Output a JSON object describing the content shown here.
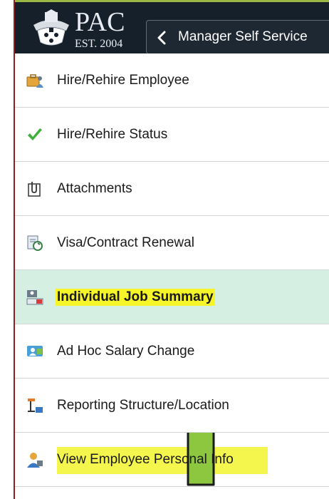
{
  "header": {
    "logo_text": "PAC",
    "logo_est": "EST. 2004",
    "back_label": "Manager Self Service"
  },
  "menu": {
    "items": [
      {
        "label": "Hire/Rehire Employee",
        "icon": "briefcase-person-icon"
      },
      {
        "label": "Hire/Rehire Status",
        "icon": "checkmark-icon"
      },
      {
        "label": "Attachments",
        "icon": "paperclip-icon"
      },
      {
        "label": "Visa/Contract Renewal",
        "icon": "document-refresh-icon"
      },
      {
        "label": "Individual Job Summary",
        "icon": "org-person-icon"
      },
      {
        "label": "Ad Hoc Salary Change",
        "icon": "money-person-icon"
      },
      {
        "label": "Reporting Structure/Location",
        "icon": "hierarchy-icon"
      },
      {
        "label": "View Employee Personal Info",
        "icon": "person-info-icon"
      }
    ]
  },
  "colors": {
    "header_bg": "#16202a",
    "header_accent": "#9ab843",
    "selected_bg": "#d6efe3",
    "highlight_yellow": "#f2f52e",
    "arrow_green": "#8dc63f",
    "frame_border": "#8b2020"
  }
}
